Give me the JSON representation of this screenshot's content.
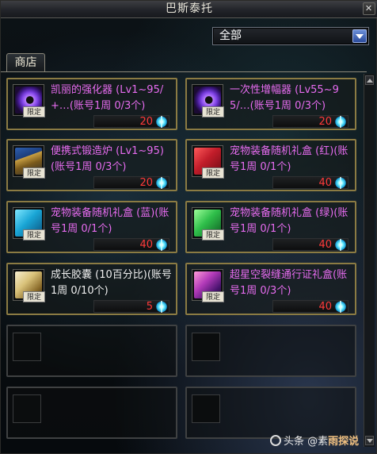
{
  "window": {
    "title": "巴斯泰托",
    "close_glyph": "✕"
  },
  "filter": {
    "selected": "全部"
  },
  "tabs": [
    {
      "label": "商店"
    }
  ],
  "items": [
    {
      "name": "凯丽的强化器 (Lv1~95/+…(账号1周 0/3个)",
      "name_color": "#e76cf0",
      "price": "20",
      "limited": "限定",
      "icon": "purple-orb-icon"
    },
    {
      "name": "一次性增幅器 (Lv55~95/…(账号1周 0/3个)",
      "name_color": "#e76cf0",
      "price": "20",
      "limited": "限定",
      "icon": "purple-orb-icon"
    },
    {
      "name": "便携式锻造炉 (Lv1~95)(账号1周 0/3个)",
      "name_color": "#e76cf0",
      "price": "20",
      "limited": "限定",
      "icon": "forge-icon"
    },
    {
      "name": "宠物装备随机礼盒 (红)(账号1周 0/1个)",
      "name_color": "#e76cf0",
      "price": "40",
      "limited": "限定",
      "icon": "red-giftbox-icon"
    },
    {
      "name": "宠物装备随机礼盒 (蓝)(账号1周 0/1个)",
      "name_color": "#e76cf0",
      "price": "40",
      "limited": "限定",
      "icon": "blue-giftbox-icon"
    },
    {
      "name": "宠物装备随机礼盒 (绿)(账号1周 0/1个)",
      "name_color": "#e76cf0",
      "price": "40",
      "limited": "限定",
      "icon": "green-giftbox-icon"
    },
    {
      "name": "成长胶囊 (10百分比)(账号1周 0/10个)",
      "name_color": "#eeeeee",
      "price": "5",
      "limited": "限定",
      "icon": "capsule-icon"
    },
    {
      "name": "超星空裂缝通行证礼盒(账号1周 0/3个)",
      "name_color": "#e76cf0",
      "price": "40",
      "limited": "限定",
      "icon": "pass-giftbox-icon"
    }
  ],
  "colors": {
    "card_border": "#8b7b43",
    "price": "#ff3a3a",
    "name_pink": "#e76cf0"
  },
  "footer": {
    "prefix": "头条",
    "at": "@素",
    "brand": "雨探说"
  }
}
